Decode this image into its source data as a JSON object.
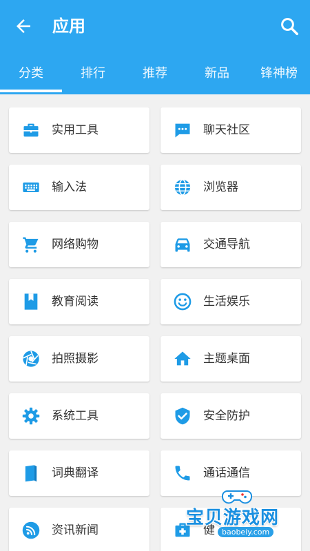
{
  "header": {
    "title": "应用",
    "background_color": "#2da7f1",
    "back_icon": "arrow-left-icon",
    "search_icon": "search-icon"
  },
  "tabs": [
    {
      "label": "分类",
      "active": true
    },
    {
      "label": "排行",
      "active": false
    },
    {
      "label": "推荐",
      "active": false
    },
    {
      "label": "新品",
      "active": false
    },
    {
      "label": "锋神榜",
      "active": false
    }
  ],
  "categories": [
    {
      "label": "实用工具",
      "icon": "toolbox-icon"
    },
    {
      "label": "聊天社区",
      "icon": "chat-icon"
    },
    {
      "label": "输入法",
      "icon": "keyboard-icon"
    },
    {
      "label": "浏览器",
      "icon": "globe-icon"
    },
    {
      "label": "网络购物",
      "icon": "cart-icon"
    },
    {
      "label": "交通导航",
      "icon": "car-icon"
    },
    {
      "label": "教育阅读",
      "icon": "bookmark-icon"
    },
    {
      "label": "生活娱乐",
      "icon": "smiley-icon"
    },
    {
      "label": "拍照摄影",
      "icon": "camera-aperture-icon"
    },
    {
      "label": "主题桌面",
      "icon": "home-icon"
    },
    {
      "label": "系统工具",
      "icon": "gear-icon"
    },
    {
      "label": "安全防护",
      "icon": "shield-icon"
    },
    {
      "label": "词典翻译",
      "icon": "book-icon"
    },
    {
      "label": "通话通信",
      "icon": "phone-icon"
    },
    {
      "label": "资讯新闻",
      "icon": "rss-icon"
    },
    {
      "label": "健",
      "icon": "medical-kit-icon"
    }
  ],
  "accent_color": "#1e9be6",
  "watermark": {
    "title": "宝贝游戏网",
    "url": "baobeiy.com"
  }
}
